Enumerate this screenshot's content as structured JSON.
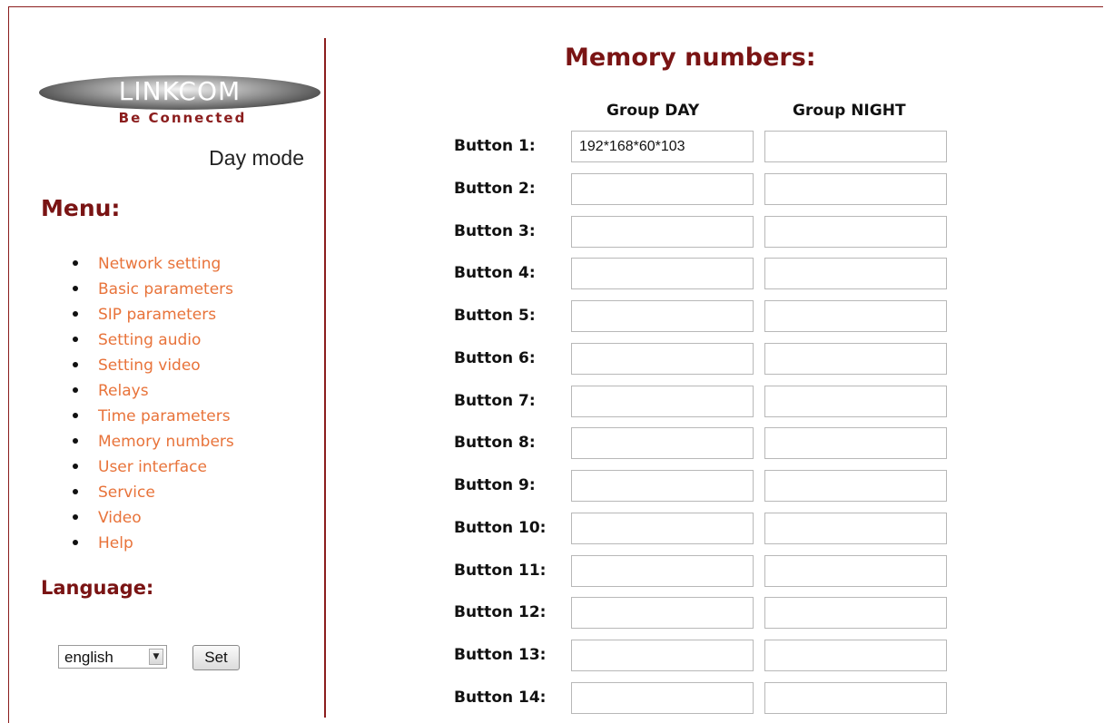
{
  "logo": {
    "name": "LINKCOM",
    "tagline": "Be Connected"
  },
  "mode_label": "Day mode",
  "menu": {
    "title": "Menu:",
    "items": [
      "Network setting",
      "Basic parameters",
      "SIP parameters",
      "Setting audio",
      "Setting video",
      "Relays",
      "Time parameters",
      "Memory numbers",
      "User interface",
      "Service",
      "Video",
      "Help"
    ]
  },
  "language": {
    "title": "Language:",
    "selected": "english",
    "set_label": "Set"
  },
  "main": {
    "title": "Memory numbers:",
    "col_day": "Group DAY",
    "col_night": "Group NIGHT",
    "rows": [
      {
        "label": "Button 1:",
        "day": "192*168*60*103",
        "night": ""
      },
      {
        "label": "Button 2:",
        "day": "",
        "night": ""
      },
      {
        "label": "Button 3:",
        "day": "",
        "night": ""
      },
      {
        "label": "Button 4:",
        "day": "",
        "night": ""
      },
      {
        "label": "Button 5:",
        "day": "",
        "night": ""
      },
      {
        "label": "Button 6:",
        "day": "",
        "night": ""
      },
      {
        "label": "Button 7:",
        "day": "",
        "night": ""
      },
      {
        "label": "Button 8:",
        "day": "",
        "night": ""
      },
      {
        "label": "Button 9:",
        "day": "",
        "night": ""
      },
      {
        "label": "Button 10:",
        "day": "",
        "night": ""
      },
      {
        "label": "Button 11:",
        "day": "",
        "night": ""
      },
      {
        "label": "Button 12:",
        "day": "",
        "night": ""
      },
      {
        "label": "Button 13:",
        "day": "",
        "night": ""
      },
      {
        "label": "Button 14:",
        "day": "",
        "night": ""
      }
    ]
  },
  "colors": {
    "accent": "#7a1414",
    "link": "#e8733a",
    "divider": "#8b1d1d"
  },
  "icons": {
    "select_arrow": "chevron-down-icon",
    "bullet": "bullet-icon"
  }
}
